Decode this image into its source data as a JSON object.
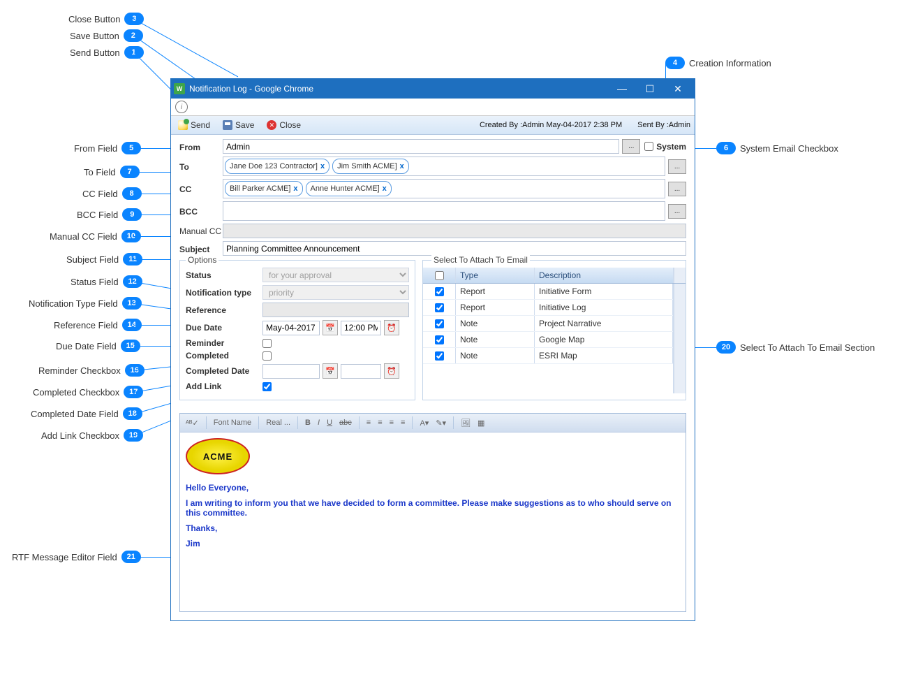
{
  "callouts": {
    "c1": "Send Button",
    "c2": "Save Button",
    "c3": "Close Button",
    "c4": "Creation Information",
    "c5": "From Field",
    "c6": "System Email Checkbox",
    "c7": "To Field",
    "c8": "CC Field",
    "c9": "BCC Field",
    "c10": "Manual CC Field",
    "c11": "Subject Field",
    "c12": "Status Field",
    "c13": "Notification Type Field",
    "c14": "Reference Field",
    "c15": "Due Date Field",
    "c16": "Reminder Checkbox",
    "c17": "Completed Checkbox",
    "c18": "Completed Date Field",
    "c19": "Add Link Checkbox",
    "c20": "Select To Attach To Email Section",
    "c21": "RTF Message Editor Field"
  },
  "nums": {
    "c1": "1",
    "c2": "2",
    "c3": "3",
    "c4": "4",
    "c5": "5",
    "c6": "6",
    "c7": "7",
    "c8": "8",
    "c9": "9",
    "c10": "10",
    "c11": "11",
    "c12": "12",
    "c13": "13",
    "c14": "14",
    "c15": "15",
    "c16": "16",
    "c17": "17",
    "c18": "18",
    "c19": "19",
    "c20": "20",
    "c21": "21"
  },
  "window": {
    "title": "Notification Log - Google Chrome"
  },
  "toolbar": {
    "send": "Send",
    "save": "Save",
    "close": "Close",
    "created": "Created By :Admin May-04-2017 2:38 PM",
    "sentby": "Sent By :Admin"
  },
  "fields": {
    "from_label": "From",
    "from_val": "Admin",
    "system": "System",
    "to_label": "To",
    "to_pills": [
      "Jane Doe 123 Contractor]",
      "Jim Smith ACME]"
    ],
    "cc_label": "CC",
    "cc_pills": [
      "Bill Parker ACME]",
      "Anne Hunter ACME]"
    ],
    "bcc_label": "BCC",
    "manualcc_label": "Manual CC",
    "subject_label": "Subject",
    "subject_val": "Planning Committee Announcement",
    "browse": "..."
  },
  "options": {
    "legend": "Options",
    "status_label": "Status",
    "status_val": "for your approval",
    "type_label": "Notification type",
    "type_val": "priority",
    "ref_label": "Reference",
    "due_label": "Due Date",
    "due_date": "May-04-2017",
    "due_time": "12:00 PM",
    "reminder_label": "Reminder",
    "completed_label": "Completed",
    "compdate_label": "Completed Date",
    "addlink_label": "Add Link"
  },
  "attach": {
    "legend": "Select To Attach To Email",
    "col_type": "Type",
    "col_desc": "Description",
    "rows": [
      {
        "type": "Report",
        "desc": "Initiative Form"
      },
      {
        "type": "Report",
        "desc": "Initiative Log"
      },
      {
        "type": "Note",
        "desc": "Project Narrative"
      },
      {
        "type": "Note",
        "desc": "Google Map"
      },
      {
        "type": "Note",
        "desc": "ESRI Map"
      }
    ]
  },
  "rtf": {
    "font_name": "Font Name",
    "font_size": "Real ...",
    "logo": "ACME",
    "p1": "Hello Everyone,",
    "p2": "I am writing to inform you that we have decided to form a committee. Please make suggestions as to who should serve on this committee.",
    "p3": "Thanks,",
    "p4": "Jim"
  }
}
